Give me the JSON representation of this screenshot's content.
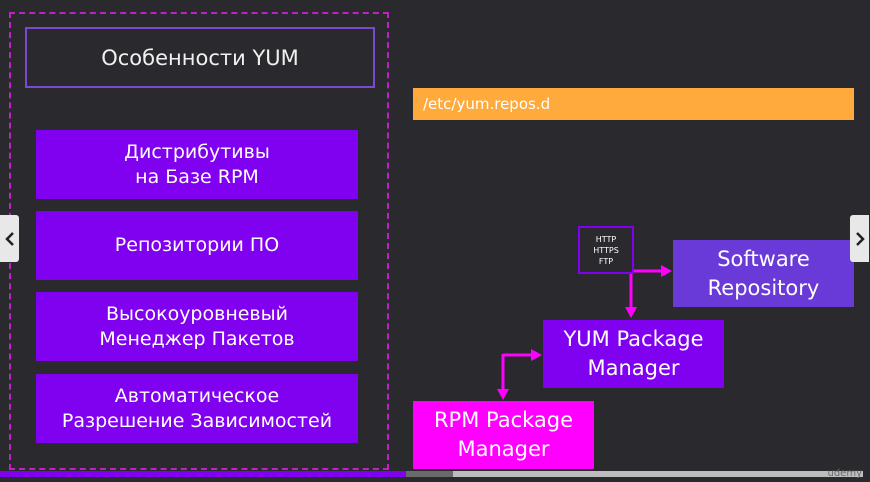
{
  "title": "Особенности YUM",
  "features": [
    "Дистрибутивы\nна Базе RPM",
    "Репозитории ПО",
    "Высокоуровневый\nМенеджер Пакетов",
    "Автоматическое\nРазрешение Зависимостей"
  ],
  "config_path": "/etc/yum.repos.d",
  "protocols": [
    "HTTP",
    "HTTPS",
    "FTP"
  ],
  "nodes": {
    "software_repository": "Software\nRepository",
    "yum_package_manager": "YUM Package\nManager",
    "rpm_package_manager": "RPM Package\nManager"
  },
  "colors": {
    "background": "#2a2a2e",
    "feature_box": "#8000f0",
    "path_bar": "#ffaa3c",
    "software_repository": "#6a3ad8",
    "rpm_box": "#ff00ff",
    "dashed_frame": "#c020c8"
  },
  "nav": {
    "prev_icon": "chevron-left-icon",
    "next_icon": "chevron-right-icon"
  },
  "progress": {
    "played_fraction": 0.47,
    "buffered_fraction": 0.525
  },
  "watermark": "udemy"
}
